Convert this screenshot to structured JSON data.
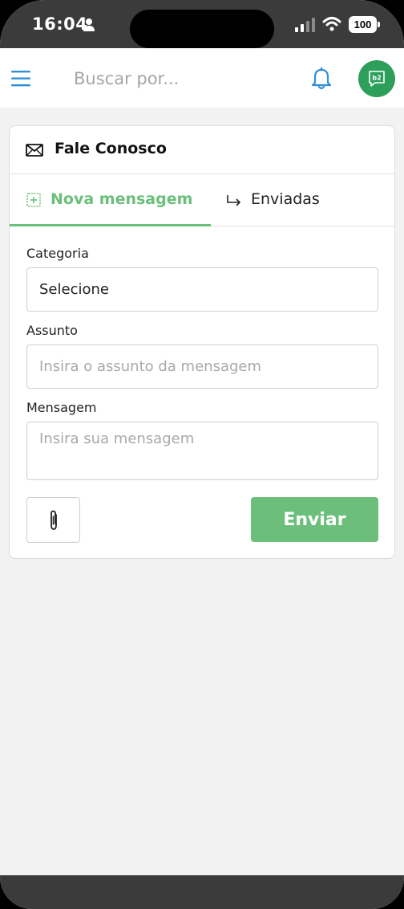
{
  "status_bar": {
    "time": "16:04",
    "battery": "100"
  },
  "header": {
    "search_placeholder": "Buscar por...",
    "avatar_text": "b2"
  },
  "card": {
    "title": "Fale Conosco",
    "tabs": [
      {
        "label": "Nova mensagem",
        "active": true
      },
      {
        "label": "Enviadas",
        "active": false
      }
    ],
    "fields": {
      "category_label": "Categoria",
      "category_value": "Selecione",
      "subject_label": "Assunto",
      "subject_placeholder": "Insira o assunto da mensagem",
      "message_label": "Mensagem",
      "message_placeholder": "Insira sua mensagem"
    },
    "send_label": "Enviar"
  },
  "colors": {
    "accent_green": "#6bbf7b",
    "avatar_green": "#2e9e5b",
    "icon_blue": "#2f8fd8",
    "status_bar": "#3b3b3b"
  },
  "icons": [
    "person-icon",
    "signal-icon",
    "wifi-icon",
    "menu-icon",
    "bell-icon",
    "mail-icon",
    "plus-box-icon",
    "reply-icon",
    "paperclip-icon"
  ]
}
